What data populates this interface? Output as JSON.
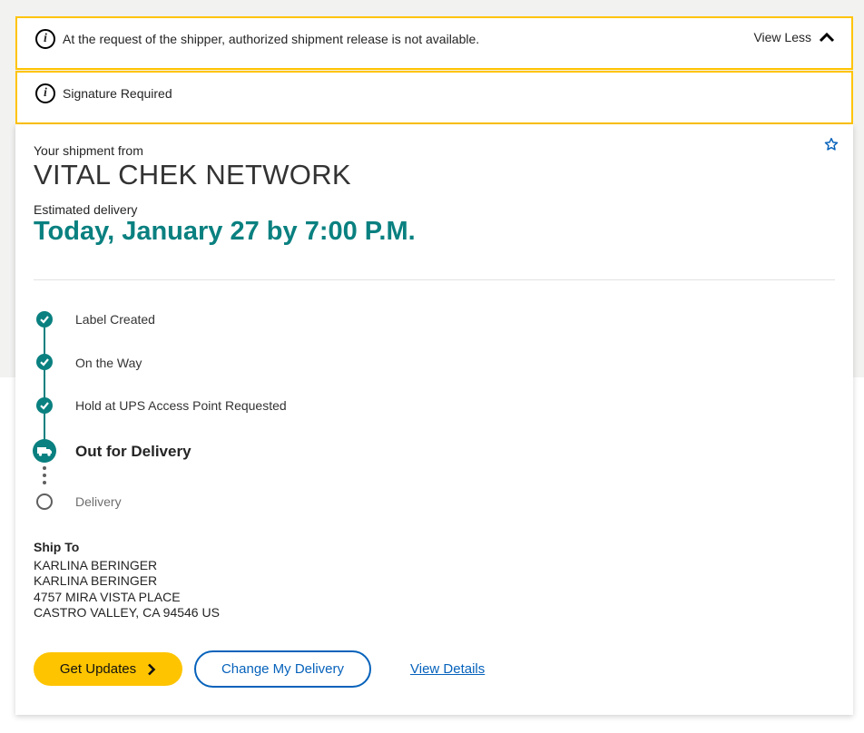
{
  "alerts": [
    {
      "message": "At the request of the shipper, authorized shipment release is not available.",
      "icon": "info-icon"
    },
    {
      "message": "Signature Required",
      "icon": "info-icon"
    }
  ],
  "alert_toggle": {
    "label": "View Less",
    "icon": "chevron-up-icon"
  },
  "shipment": {
    "from_label": "Your shipment from",
    "shipper": "VITAL CHEK NETWORK",
    "estimated_label": "Estimated delivery",
    "estimated_delivery": "Today, January 27 by 7:00 P.M.",
    "favorite_icon": "star-icon"
  },
  "progress": [
    {
      "label": "Label Created",
      "status": "complete"
    },
    {
      "label": "On the Way",
      "status": "complete"
    },
    {
      "label": "Hold at UPS Access Point Requested",
      "status": "complete"
    },
    {
      "label": "Out for Delivery",
      "status": "current"
    },
    {
      "label": "Delivery",
      "status": "pending"
    }
  ],
  "ship_to": {
    "heading": "Ship To",
    "lines": [
      "KARLINA BERINGER",
      "KARLINA BERINGER",
      "4757 MIRA VISTA PLACE",
      "CASTRO VALLEY, CA 94546 US"
    ]
  },
  "actions": {
    "get_updates": "Get Updates",
    "change_delivery": "Change My Delivery",
    "view_details": "View Details"
  },
  "colors": {
    "accent_yellow": "#ffc400",
    "teal": "#0a8080",
    "link_blue": "#0662bb",
    "background_gray": "#f2f2f1"
  }
}
